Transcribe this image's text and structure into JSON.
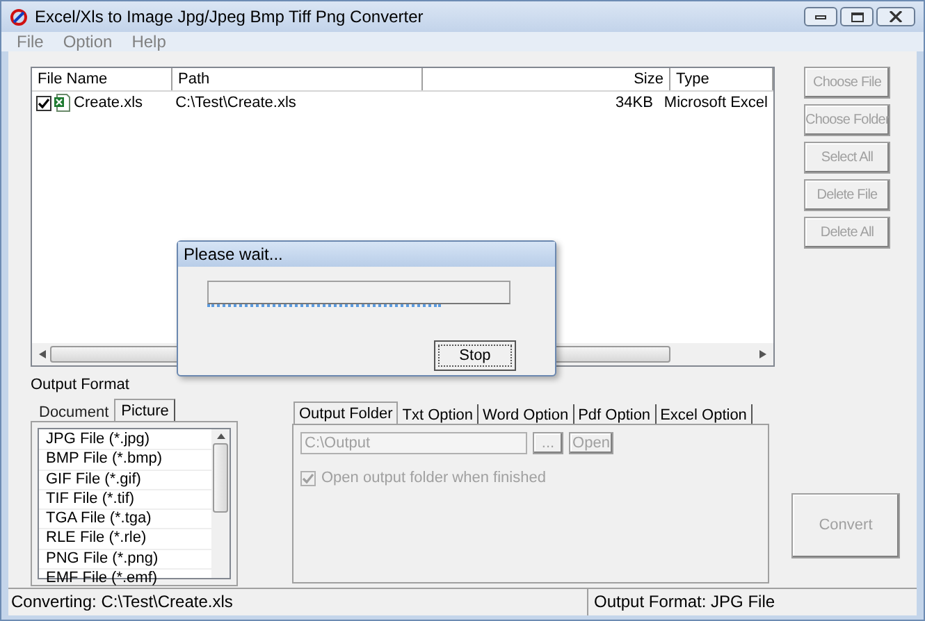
{
  "window": {
    "title": "Excel/Xls to Image Jpg/Jpeg Bmp Tiff Png Converter"
  },
  "menu": [
    "File",
    "Option",
    "Help"
  ],
  "file_list": {
    "columns": [
      "File Name",
      "Path",
      "Size",
      "Type"
    ],
    "rows": [
      {
        "checked": true,
        "cells": [
          "Create.xls",
          "C:\\Test\\Create.xls",
          "34KB",
          "Microsoft Excel"
        ]
      }
    ]
  },
  "side_buttons": [
    {
      "label": "Choose File",
      "disabled": true
    },
    {
      "label": "Choose Folder",
      "disabled": true
    },
    {
      "label": "Select All",
      "disabled": true
    },
    {
      "label": "Delete File",
      "disabled": true
    },
    {
      "label": "Delete All",
      "disabled": true
    }
  ],
  "output_format": {
    "label": "Output Format",
    "tabs": [
      {
        "label": "Document",
        "selected": false
      },
      {
        "label": "Picture",
        "selected": true
      }
    ],
    "formats": [
      "JPG File  (*.jpg)",
      "BMP File  (*.bmp)",
      "GIF File  (*.gif)",
      "TIF File  (*.tif)",
      "TGA File  (*.tga)",
      "RLE File  (*.rle)",
      "PNG File  (*.png)",
      "EMF File  (*.emf)"
    ]
  },
  "options": {
    "tabs": [
      {
        "label": "Output Folder",
        "selected": true
      },
      {
        "label": "Txt Option",
        "selected": false
      },
      {
        "label": "Word Option",
        "selected": false
      },
      {
        "label": "Pdf Option",
        "selected": false
      },
      {
        "label": "Excel Option",
        "selected": false
      }
    ],
    "folder_field": {
      "value": "C:\\Output",
      "disabled": true
    },
    "browse_button": {
      "label": "...",
      "disabled": true
    },
    "open_button": {
      "label": "Open",
      "disabled": true
    },
    "open_when_finished": {
      "label": "Open output folder when finished",
      "checked": true,
      "disabled": true
    }
  },
  "convert_button": {
    "label": "Convert",
    "disabled": true
  },
  "status_bar": [
    "Converting:  C:\\Test\\Create.xls",
    "Output Format: JPG File"
  ],
  "dialog": {
    "title": "Please wait...",
    "level": 0.77,
    "stop_button": "Stop"
  }
}
